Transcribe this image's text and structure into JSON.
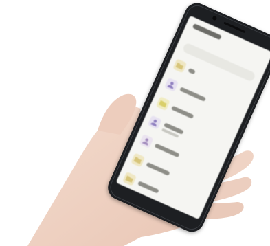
{
  "scene": {
    "background": "#ffffff",
    "skin_color": "#f1d6c8",
    "skin_shadow": "#e0bfb0",
    "phone_color": "#1d1f22"
  },
  "phone_app": {
    "rows": [
      {
        "icon": "folder-icon",
        "icon_color": "#d7c57a"
      },
      {
        "icon": "person-icon",
        "icon_color": "#8f7fbf"
      },
      {
        "icon": "folder-icon",
        "icon_color": "#d9cf6a"
      },
      {
        "icon": "person-icon",
        "icon_color": "#8f7fbf"
      },
      {
        "icon": "person-icon",
        "icon_color": "#a58fbf"
      },
      {
        "icon": "folder-icon",
        "icon_color": "#d7c57a"
      },
      {
        "icon": "folder-icon",
        "icon_color": "#d7c57a"
      }
    ]
  }
}
